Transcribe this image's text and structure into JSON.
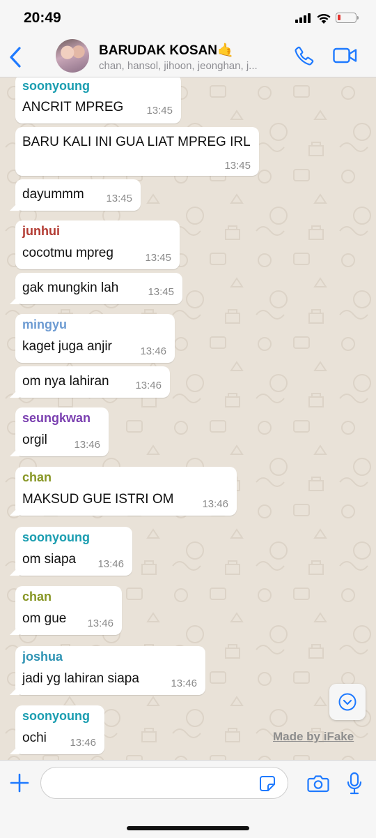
{
  "status_bar": {
    "time": "20:49",
    "battery_level": 0.18,
    "battery_color": "#e2342e"
  },
  "header": {
    "title": "BARUDAK KOSAN🤙",
    "subtitle": "chan, hansol, jihoon, jeonghan, j...",
    "accent_color": "#1f7aff"
  },
  "messages": [
    {
      "sender": "soonyoung",
      "sender_color": "#1a9db0",
      "text": "ANCRIT MPREG",
      "time": "13:45"
    },
    {
      "sender": "",
      "sender_color": "",
      "text": "BARU KALI INI GUA LIAT MPREG IRL",
      "time": "13:45"
    },
    {
      "sender": "",
      "sender_color": "",
      "text": "dayummm",
      "time": "13:45"
    },
    {
      "sender": "junhui",
      "sender_color": "#b23a32",
      "text": "cocotmu mpreg",
      "time": "13:45"
    },
    {
      "sender": "",
      "sender_color": "",
      "text": "gak mungkin lah",
      "time": "13:45"
    },
    {
      "sender": "mingyu",
      "sender_color": "#6d9bd2",
      "text": "kaget juga anjir",
      "time": "13:46"
    },
    {
      "sender": "",
      "sender_color": "",
      "text": "om nya lahiran",
      "time": "13:46"
    },
    {
      "sender": "seungkwan",
      "sender_color": "#7a3fb0",
      "text": "orgil",
      "time": "13:46"
    },
    {
      "sender": "chan",
      "sender_color": "#879624",
      "text": "MAKSUD GUE ISTRI OM",
      "time": "13:46"
    },
    {
      "sender": "soonyoung",
      "sender_color": "#1a9db0",
      "text": "om siapa",
      "time": "13:46"
    },
    {
      "sender": "chan",
      "sender_color": "#879624",
      "text": "om gue",
      "time": "13:46"
    },
    {
      "sender": "joshua",
      "sender_color": "#2e93b3",
      "text": "jadi yg lahiran siapa",
      "time": "13:46"
    },
    {
      "sender": "soonyoung",
      "sender_color": "#1a9db0",
      "text": "ochi",
      "time": "13:46"
    }
  ],
  "watermark": "Made by iFake",
  "input": {
    "value": "",
    "placeholder": ""
  },
  "icons": {
    "back": "chevron-left-icon",
    "call": "phone-icon",
    "video": "video-camera-icon",
    "scroll_down": "chevron-down-circle-icon",
    "plus": "plus-icon",
    "sticker": "sticker-icon",
    "camera": "camera-icon",
    "mic": "microphone-icon"
  }
}
